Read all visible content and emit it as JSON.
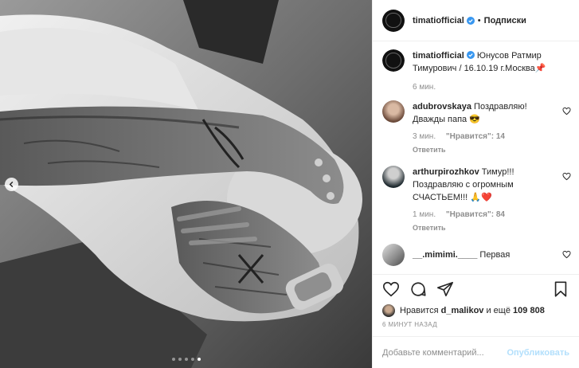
{
  "post": {
    "username": "timatiofficial",
    "follow_label": "Подписки",
    "separator": "•"
  },
  "caption": {
    "username": "timatiofficial",
    "text": "Юнусов Ратмир Тимурович / 16.10.19 г.Москва📌",
    "time": "6 мин."
  },
  "comments": [
    {
      "username": "adubrovskaya",
      "text": "Поздравляю! Дважды папа 😎",
      "time": "3 мин.",
      "likes": "\"Нравится\": 14",
      "reply": "Ответить"
    },
    {
      "username": "arthurpirozhkov",
      "text": "Тимур!!! Поздравляю с огромным СЧАСТЬЕМ!!! 🙏❤️",
      "time": "1 мин.",
      "likes": "\"Нравится\": 84",
      "reply": "Ответить"
    },
    {
      "username": "__.mimimi.____",
      "text": "Первая"
    }
  ],
  "likes": {
    "prefix": "Нравится",
    "user": "d_malikov",
    "middle": "и ещё",
    "count": "109 808"
  },
  "timestamp": "6 МИНУТ НАЗАД",
  "comment_box": {
    "placeholder": "Добавьте комментарий...",
    "publish_label": "Опубликовать"
  },
  "carousel": {
    "count": 5,
    "active_index": 4
  },
  "icons": {
    "like": "heart-icon",
    "comment": "comment-icon",
    "share": "share-icon",
    "save": "bookmark-icon",
    "verified": "verified-badge-icon",
    "prev": "chevron-left-icon"
  },
  "colors": {
    "verified": "#3897f0",
    "publish": "#b2dffc",
    "muted": "#8e8e8e"
  }
}
